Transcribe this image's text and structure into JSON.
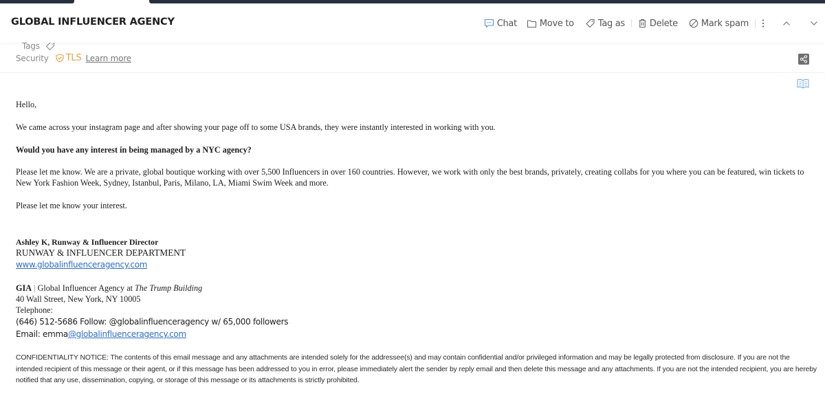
{
  "window": {
    "topbar_color": "#28303f",
    "accent": "#2f6dc2",
    "tls_color": "#e3a044"
  },
  "header": {
    "subject": "GLOBAL INFLUENCER AGENCY",
    "toolbar": {
      "chat": "Chat",
      "move_to": "Move to",
      "tag_as": "Tag as",
      "delete": "Delete",
      "mark_spam": "Mark spam",
      "icons": [
        "chat-icon",
        "folder-icon",
        "tag-icon",
        "trash-icon",
        "block-icon",
        "more-vertical-icon",
        "chevron-up-icon",
        "chevron-down-icon"
      ]
    }
  },
  "meta": {
    "tags_label": "Tags",
    "security_label": "Security",
    "security_value": "TLS",
    "learn_more": "Learn more"
  },
  "email": {
    "greeting": "Hello,",
    "p1": "We came across your instagram page and after showing your page off to some USA brands, they were instantly interested in working with you.",
    "p2": "Would you have any interest in being managed by a NYC agency?",
    "p3": "Please let me know. We are a private, global boutique working with over 5,500 Influencers in over 160 countries. However, we work with only the best brands, privately, creating collabs for you where you can be featured, win tickets to New York Fashion Week, Sydney, Istanbul, Paris, Milano, LA, Miami Swim Week and more.",
    "p4": "Please let me know your interest.",
    "signature": {
      "name_title": "Ashley K, Runway & Influencer Director",
      "department": "RUNWAY & INFLUENCER DEPARTMENT",
      "website": "www.globalinfluenceragency.com",
      "org_abbr": "GIA",
      "org_sep": " | ",
      "org_name": "Global Influencer Agency at ",
      "building": "The Trump Building",
      "address": "40 Wall Street, New York, NY 10005",
      "telephone_label": "Telephone:",
      "phone_line": "(646) 512-5686 Follow: @globalinfluenceragency w/ 65,000 followers",
      "email_prefix": "Email: emma",
      "email_link": "@globalinfluenceragency.com"
    },
    "notice": "CONFIDENTIALITY NOTICE: The contents of this email message and any attachments are intended solely for the addressee(s) and may contain confidential and/or privileged information and may be legally protected from disclosure. If you are not the intended recipient of this message or their agent, or if this message has been addressed to you in error, please immediately alert the sender by reply email and then delete this message and any attachments. If you are not the intended recipient, you are hereby notified that any use, dissemination, copying, or storage of this message or its attachments is strictly prohibited."
  }
}
